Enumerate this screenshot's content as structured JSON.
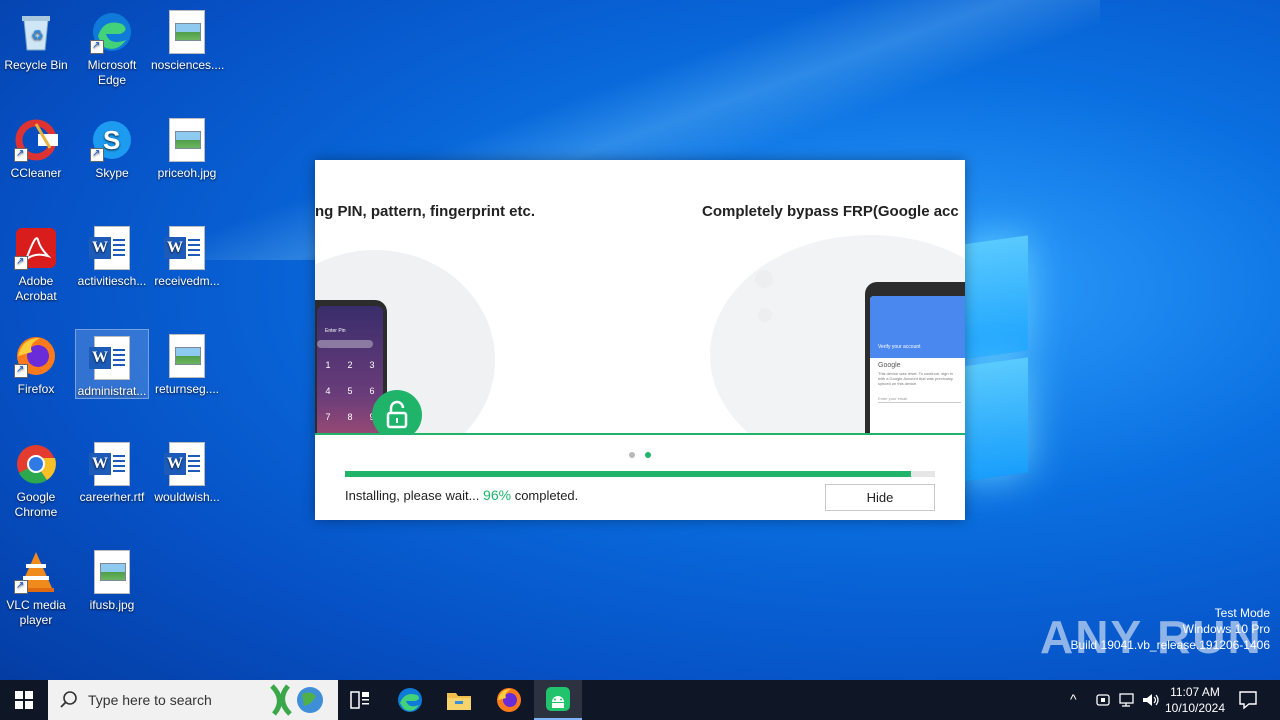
{
  "desktop": {
    "icons": [
      {
        "label": "Recycle Bin",
        "icon": "recycle-bin-icon"
      },
      {
        "label": "Microsoft Edge",
        "icon": "edge-icon"
      },
      {
        "label": "nosciences....",
        "icon": "image-file-icon"
      },
      {
        "label": "CCleaner",
        "icon": "ccleaner-icon"
      },
      {
        "label": "Skype",
        "icon": "skype-icon"
      },
      {
        "label": "priceoh.jpg",
        "icon": "image-file-icon"
      },
      {
        "label": "Adobe Acrobat",
        "icon": "acrobat-icon"
      },
      {
        "label": "activitiesch...",
        "icon": "word-file-icon"
      },
      {
        "label": "receivedm...",
        "icon": "word-file-icon"
      },
      {
        "label": "Firefox",
        "icon": "firefox-icon"
      },
      {
        "label": "administrat...",
        "icon": "word-file-icon"
      },
      {
        "label": "returnseg....",
        "icon": "image-file-icon"
      },
      {
        "label": "Google Chrome",
        "icon": "chrome-icon"
      },
      {
        "label": "careerher.rtf",
        "icon": "word-file-icon"
      },
      {
        "label": "wouldwish...",
        "icon": "word-file-icon"
      },
      {
        "label": "VLC media player",
        "icon": "vlc-icon"
      },
      {
        "label": "ifusb.jpg",
        "icon": "image-file-icon"
      }
    ]
  },
  "dialog": {
    "slide1_headline": "ng PIN, pattern, fingerprint etc.",
    "slide2_headline": "Completely bypass FRP(Google acc",
    "phone_screen": {
      "enter_pin": "Enter Pin",
      "keys": [
        "1",
        "2",
        "3",
        "4",
        "5",
        "6",
        "7",
        "8",
        "9"
      ],
      "verify_title": "Verify your account",
      "google": "Google",
      "verify_text": "This device was reset. To continue, sign in with a Google Account that was previously synced on this device.",
      "email_placeholder": "Enter your email"
    },
    "progress_percent": 96,
    "status_prefix": "Installing, please wait...",
    "status_pct": "96%",
    "status_suffix": "completed.",
    "hide_label": "Hide",
    "accent": "#1fb46a"
  },
  "watermark": {
    "brand": "ANY RUN",
    "line1": "Test Mode",
    "line2": "Windows 10 Pro",
    "line3": "Build 19041.vb_release.191206-1406"
  },
  "taskbar": {
    "search_placeholder": "Type here to search",
    "time": "11:07 AM",
    "date": "10/10/2024"
  }
}
